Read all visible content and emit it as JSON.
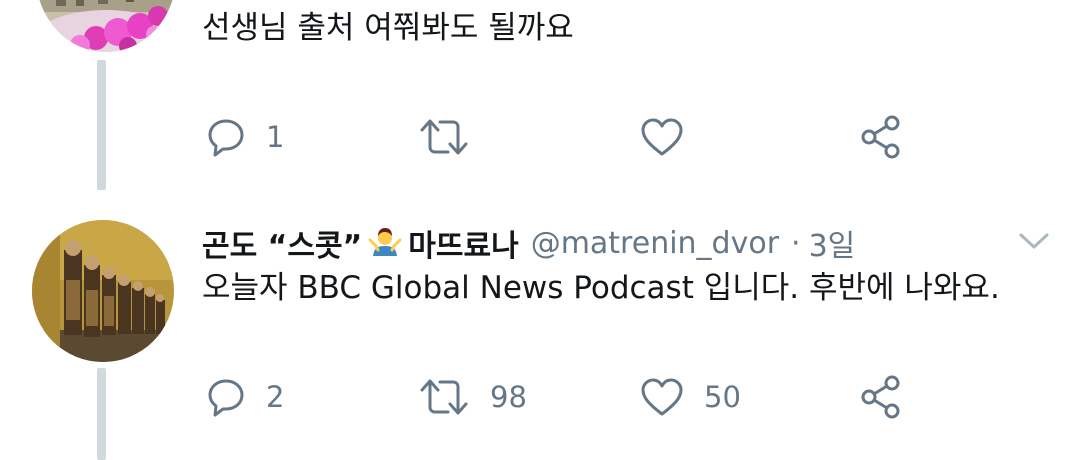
{
  "tweet1": {
    "text": "선생님 출처 여쭤봐도 될까요",
    "actions": {
      "reply_count": "1",
      "retweet_count": "",
      "like_count": ""
    }
  },
  "tweet2": {
    "display_name": "곤도 “스콧”",
    "display_name_suffix": "마뜨료나",
    "handle": "@matrenin_dvor",
    "separator": "·",
    "time": "3일",
    "text": "오늘자 BBC Global News Podcast 입니다. 후반에 나와요.",
    "actions": {
      "reply_count": "2",
      "retweet_count": "98",
      "like_count": "50"
    }
  },
  "icons": {
    "reply": "reply-icon",
    "retweet": "retweet-icon",
    "like": "heart-icon",
    "share": "share-icon",
    "more": "chevron-down-icon"
  },
  "colors": {
    "text": "#14171a",
    "secondary": "#657786",
    "thread_line": "#cfd9de",
    "icon": "#657786"
  }
}
